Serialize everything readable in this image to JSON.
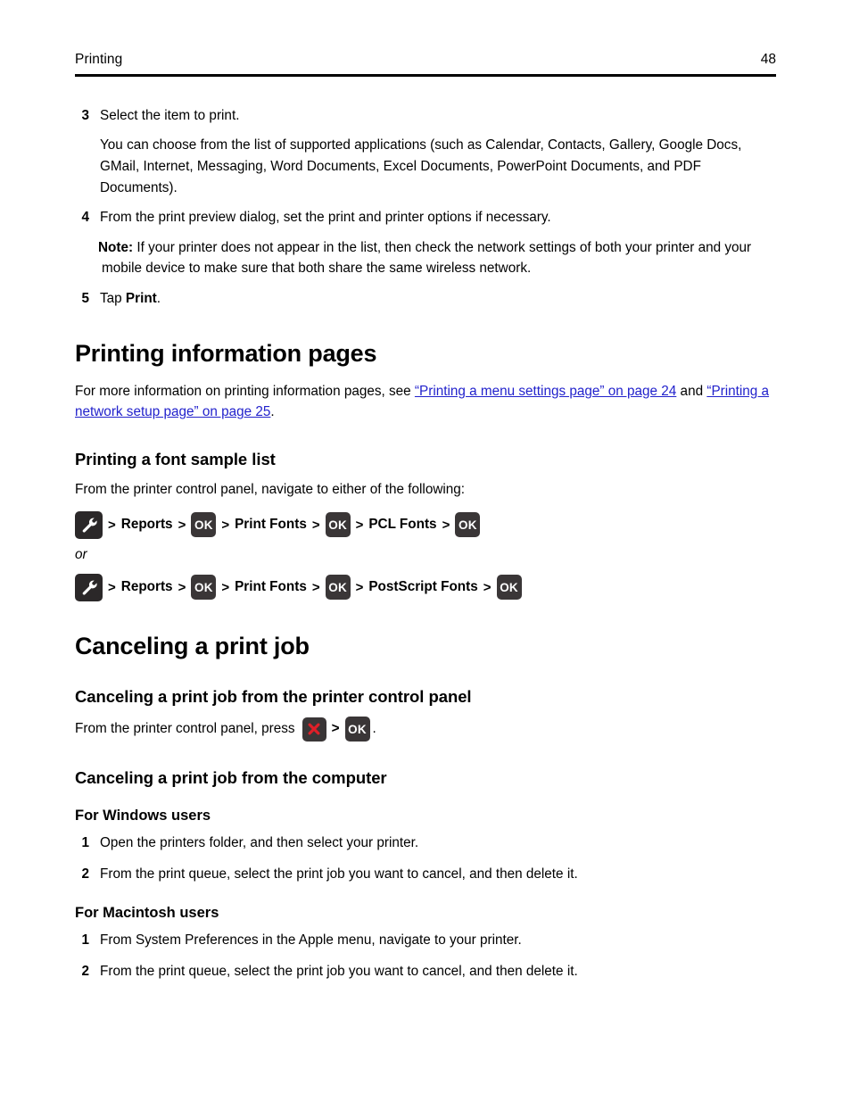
{
  "header": {
    "title": "Printing",
    "page_number": "48"
  },
  "steps_top": [
    {
      "number": "3",
      "text": "Select the item to print.",
      "detail": "You can choose from the list of supported applications (such as Calendar, Contacts, Gallery, Google Docs, GMail, Internet, Messaging, Word Documents, Excel Documents, PowerPoint Documents, and PDF Documents)."
    },
    {
      "number": "4",
      "text": "From the print preview dialog, set the print and printer options if necessary.",
      "note_label": "Note:",
      "note_text": " If your printer does not appear in the list, then check the network settings of both your printer and your mobile device to make sure that both share the same wireless network."
    },
    {
      "number": "5",
      "text_before": "Tap ",
      "text_bold": "Print",
      "text_after": "."
    }
  ],
  "section_info_pages": {
    "heading": "Printing information pages",
    "intro_before": "For more information on printing information pages, see ",
    "link1": "“Printing a menu settings page” on page 24",
    "between": " and ",
    "link2": "“Printing a network setup page” on page 25",
    "intro_after": "."
  },
  "section_font_sample": {
    "heading": "Printing a font sample list",
    "intro": "From the printer control panel, navigate to either of the following:",
    "or_label": "or",
    "path1": {
      "icon_start": "wrench-icon",
      "separator": ">",
      "items": [
        {
          "type": "label",
          "text": "Reports"
        },
        {
          "type": "icon",
          "icon": "ok-icon",
          "text": "OK"
        },
        {
          "type": "label",
          "text": "Print Fonts"
        },
        {
          "type": "icon",
          "icon": "ok-icon",
          "text": "OK"
        },
        {
          "type": "label",
          "text": "PCL Fonts"
        },
        {
          "type": "icon",
          "icon": "ok-icon",
          "text": "OK"
        }
      ]
    },
    "path2": {
      "icon_start": "wrench-icon",
      "separator": ">",
      "items": [
        {
          "type": "label",
          "text": "Reports"
        },
        {
          "type": "icon",
          "icon": "ok-icon",
          "text": "OK"
        },
        {
          "type": "label",
          "text": "Print Fonts"
        },
        {
          "type": "icon",
          "icon": "ok-icon",
          "text": "OK"
        },
        {
          "type": "label",
          "text": "PostScript Fonts"
        },
        {
          "type": "icon",
          "icon": "ok-icon",
          "text": "OK"
        }
      ]
    }
  },
  "section_cancel": {
    "heading": "Canceling a print job",
    "control_panel": {
      "heading": "Canceling a print job from the printer control panel",
      "lead_text": "From the printer control panel, press",
      "cancel_icon": "cancel-x-icon",
      "separator": ">",
      "ok_icon": "ok-icon",
      "ok_text": "OK",
      "trailing": "."
    },
    "computer": {
      "heading": "Canceling a print job from the computer",
      "windows": {
        "heading": "For Windows users",
        "steps": [
          {
            "number": "1",
            "text": "Open the printers folder, and then select your printer."
          },
          {
            "number": "2",
            "text": "From the print queue, select the print job you want to cancel, and then delete it."
          }
        ]
      },
      "macintosh": {
        "heading": "For Macintosh users",
        "steps": [
          {
            "number": "1",
            "text": "From System Preferences in the Apple menu, navigate to your printer."
          },
          {
            "number": "2",
            "text": "From the print queue, select the print job you want to cancel, and then delete it."
          }
        ]
      }
    }
  },
  "colors": {
    "link": "#2222cc",
    "icon_background": "#3a3637",
    "icon_background_dark": "#2b2829",
    "cancel_red": "#e01f28",
    "text": "#000000"
  }
}
